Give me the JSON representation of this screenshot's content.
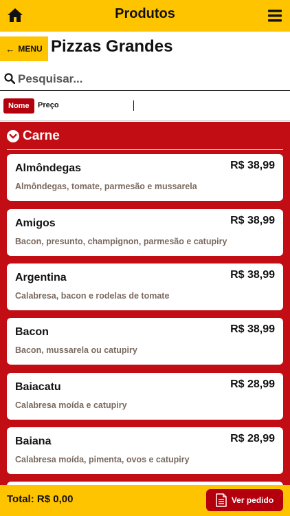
{
  "header": {
    "title": "Produtos",
    "home_icon": "home-icon",
    "menu_icon": "hamburger-menu-icon"
  },
  "subheader": {
    "back_arrow": "←",
    "menu_label": "MENU",
    "page_title": "Pizzas Grandes"
  },
  "search": {
    "placeholder": "Pesquisar...",
    "value": ""
  },
  "sort": {
    "nome_label": "Nome",
    "preco_label": "Preço",
    "active": "Nome"
  },
  "category": {
    "name": "Carne",
    "icon": "chevron-down-circle-icon"
  },
  "products": [
    {
      "name": "Almôndegas",
      "price": "R$ 38,99",
      "description": "Almôndegas, tomate, parmesão e mussarela"
    },
    {
      "name": "Amigos",
      "price": "R$ 38,99",
      "description": "Bacon, presunto, champignon, parmesão e catupiry"
    },
    {
      "name": "Argentina",
      "price": "R$ 38,99",
      "description": "Calabresa, bacon e rodelas de tomate"
    },
    {
      "name": "Bacon",
      "price": "R$ 38,99",
      "description": "Bacon, mussarela ou catupiry"
    },
    {
      "name": "Baiacatu",
      "price": "R$ 28,99",
      "description": "Calabresa moída e catupiry"
    },
    {
      "name": "Baiana",
      "price": "R$ 28,99",
      "description": "Calabresa moída, pimenta, ovos e catupiry"
    }
  ],
  "footer": {
    "total_label": "Total: R$ 0,00",
    "order_button_label": "Ver pedido",
    "order_icon": "document-icon"
  },
  "colors": {
    "yellow": "#FFC400",
    "red": "#C20D14",
    "dark_red": "#B3000C",
    "description_text": "#7A6A60"
  }
}
